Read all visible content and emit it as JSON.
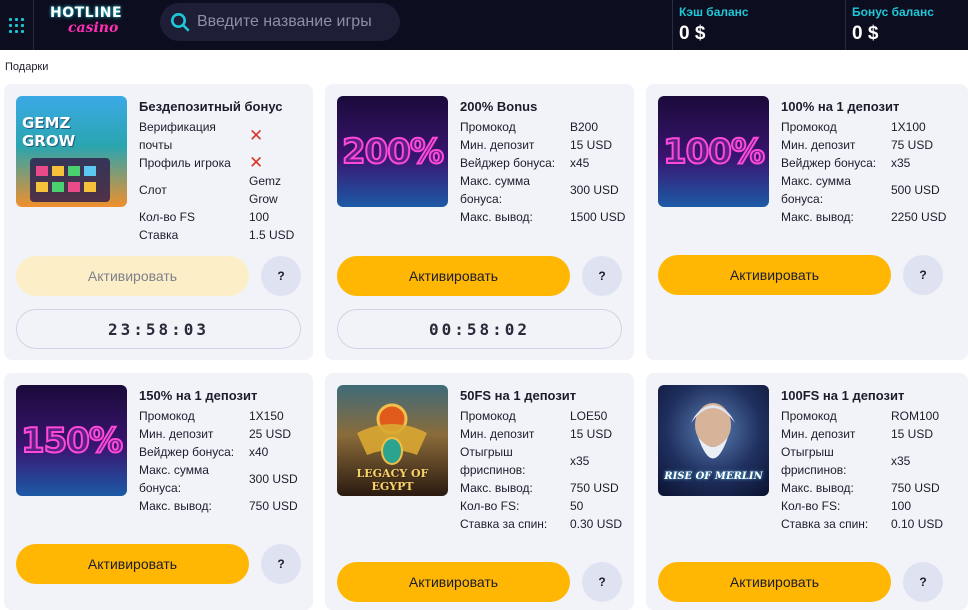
{
  "header": {
    "logo_top": "HOTLINE",
    "logo_bottom": "casino",
    "search_placeholder": "Введите название игры",
    "cash_label": "Кэш баланс",
    "cash_value": "0 $",
    "bonus_label": "Бонус баланс",
    "bonus_value": "0 $"
  },
  "breadcrumb": "Подарки",
  "cards": [
    {
      "title": "Бездепозитный бонус",
      "image_text": "GEMZ GROW",
      "rows": [
        {
          "k": "Верификация почты",
          "v": "",
          "icon": "cross-icon"
        },
        {
          "k": "Профиль игрока",
          "v": "",
          "icon": "cross-icon"
        },
        {
          "k": "Слот",
          "v": "Gemz Grow"
        },
        {
          "k": "Кол-во FS",
          "v": "100"
        },
        {
          "k": "Ставка",
          "v": "1.5 USD"
        }
      ],
      "button": "Активировать",
      "help": "?",
      "timer": "23:58:03"
    },
    {
      "title": "200% Bonus",
      "image_text": "200%",
      "rows": [
        {
          "k": "Промокод",
          "v": "B200"
        },
        {
          "k": "Мин. депозит",
          "v": "15 USD"
        },
        {
          "k": "Вейджер бонуса:",
          "v": "x45"
        },
        {
          "k": "Макс. сумма бонуса:",
          "v": "300 USD"
        },
        {
          "k": "Макс. вывод:",
          "v": "1500 USD"
        }
      ],
      "button": "Активировать",
      "help": "?",
      "timer": "00:58:02"
    },
    {
      "title": "100% на 1 депозит",
      "image_text": "100%",
      "rows": [
        {
          "k": "Промокод",
          "v": "1X100"
        },
        {
          "k": "Мин. депозит",
          "v": "75 USD"
        },
        {
          "k": "Вейджер бонуса:",
          "v": "x35"
        },
        {
          "k": "Макс. сумма бонуса:",
          "v": "500 USD"
        },
        {
          "k": "Макс. вывод:",
          "v": "2250 USD"
        }
      ],
      "button": "Активировать",
      "help": "?"
    },
    {
      "title": "150% на 1 депозит",
      "image_text": "150%",
      "rows": [
        {
          "k": "Промокод",
          "v": "1X150"
        },
        {
          "k": "Мин. депозит",
          "v": "25 USD"
        },
        {
          "k": "Вейджер бонуса:",
          "v": "x40"
        },
        {
          "k": "Макс. сумма бонуса:",
          "v": "300 USD"
        },
        {
          "k": "Макс. вывод:",
          "v": "750 USD"
        }
      ],
      "button": "Активировать",
      "help": "?"
    },
    {
      "title": "50FS на 1 депозит",
      "image_text": "LEGACY OF EGYPT",
      "rows": [
        {
          "k": "Промокод",
          "v": "LOE50"
        },
        {
          "k": "Мин. депозит",
          "v": "15 USD"
        },
        {
          "k": "Отыгрыш фриспинов:",
          "v": "x35"
        },
        {
          "k": "Макс. вывод:",
          "v": "750 USD"
        },
        {
          "k": "Кол-во FS:",
          "v": "50"
        },
        {
          "k": "Ставка за спин:",
          "v": "0.30 USD"
        }
      ],
      "button": "Активировать",
      "help": "?"
    },
    {
      "title": "100FS на 1 депозит",
      "image_text": "RISE OF MERLIN",
      "rows": [
        {
          "k": "Промокод",
          "v": "ROM100"
        },
        {
          "k": "Мин. депозит",
          "v": "15 USD"
        },
        {
          "k": "Отыгрыш фриспинов:",
          "v": "x35"
        },
        {
          "k": "Макс. вывод:",
          "v": "750 USD"
        },
        {
          "k": "Кол-во FS:",
          "v": "100"
        },
        {
          "k": "Ставка за спин:",
          "v": "0.10 USD"
        }
      ],
      "button": "Активировать",
      "help": "?"
    }
  ],
  "colors": {
    "header_bg": "#0c0d1f",
    "accent_cyan": "#1ec8d8",
    "button_yellow": "#ffb703",
    "card_bg": "#f1f3f9",
    "cross_red": "#d8372b"
  }
}
